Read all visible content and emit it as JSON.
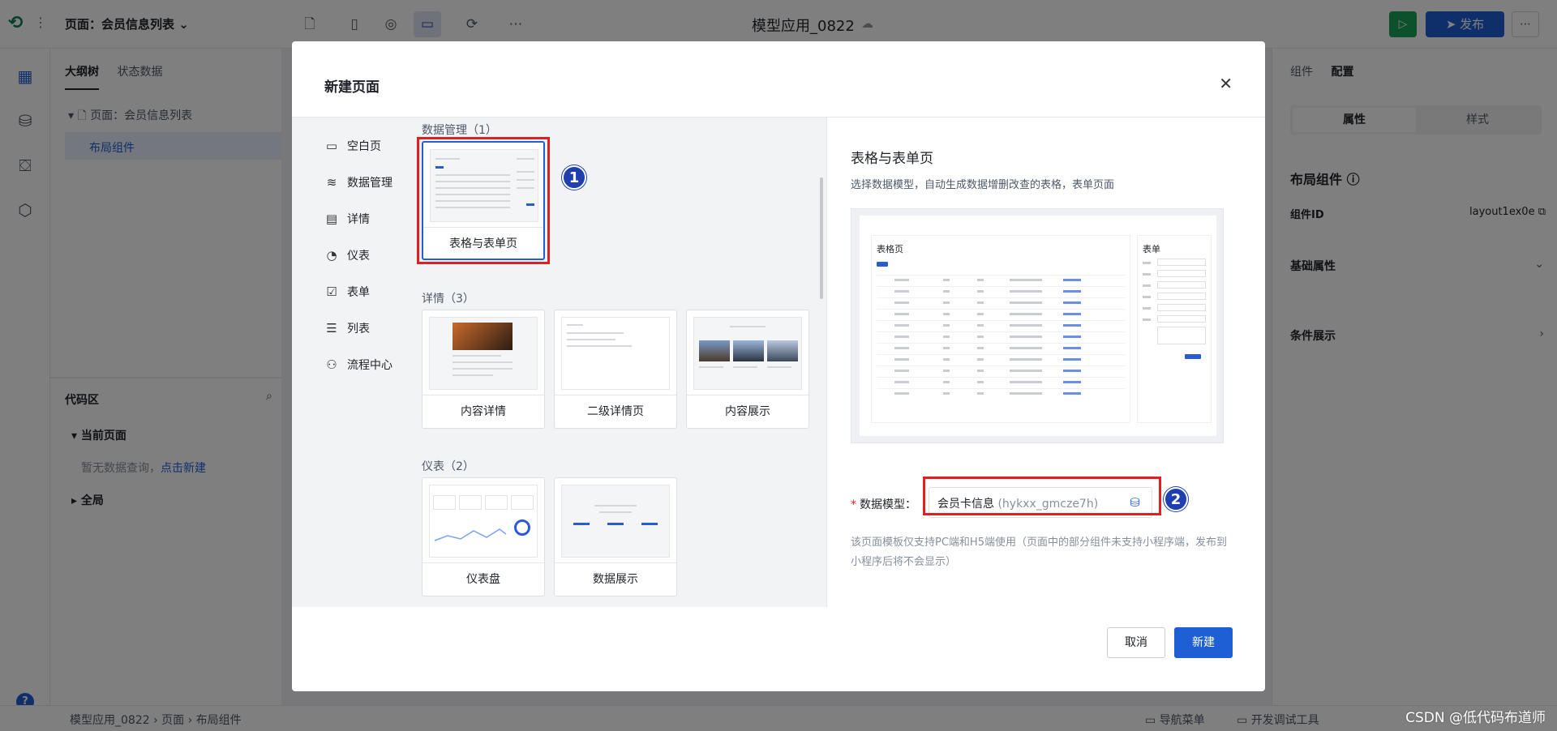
{
  "editor": {
    "page_selector": "页面：会员信息列表",
    "app_title": "模型应用_0822",
    "publish_label": "发布",
    "left_tabs": [
      "大纲树",
      "状态数据"
    ],
    "tree_page": "页面：会员信息列表",
    "tree_layout": "布局组件",
    "code_zone_title": "代码区",
    "code_current": "当前页面",
    "code_empty_text": "暂无数据查询，",
    "code_empty_link": "点击新建",
    "code_global": "全局",
    "right_tabs": [
      "组件",
      "配置"
    ],
    "seg_props": "属性",
    "seg_style": "样式",
    "component_name": "布局组件",
    "component_id_label": "组件ID",
    "component_id_value": "layout1ex0e",
    "section_basic": "基础属性",
    "section_condition": "条件展示",
    "breadcrumb": [
      "模型应用_0822",
      "页面",
      "布局组件"
    ],
    "bottom_tools": [
      "导航菜单",
      "开发调试工具"
    ],
    "watermark": "CSDN @低代码布道师"
  },
  "modal": {
    "title": "新建页面",
    "categories": [
      {
        "icon": "blank-page-icon",
        "glyph": "▭",
        "label": "空白页"
      },
      {
        "icon": "layers-icon",
        "glyph": "≋",
        "label": "数据管理"
      },
      {
        "icon": "detail-icon",
        "glyph": "▤",
        "label": "详情"
      },
      {
        "icon": "gauge-icon",
        "glyph": "◔",
        "label": "仪表"
      },
      {
        "icon": "checkbox-icon",
        "glyph": "☑",
        "label": "表单"
      },
      {
        "icon": "list-icon",
        "glyph": "☰",
        "label": "列表"
      },
      {
        "icon": "flow-icon",
        "glyph": "⚇",
        "label": "流程中心"
      }
    ],
    "groups": {
      "data_manage": {
        "title": "数据管理（1）",
        "templates": [
          "表格与表单页"
        ]
      },
      "detail": {
        "title": "详情（3）",
        "templates": [
          "内容详情",
          "二级详情页",
          "内容展示"
        ]
      },
      "dashboard": {
        "title": "仪表（2）",
        "templates": [
          "仪表盘",
          "数据展示"
        ]
      }
    },
    "selected": {
      "title": "表格与表单页",
      "description": "选择数据模型，自动生成数据增删改查的表格，表单页面",
      "preview_table_title": "表格页",
      "preview_form_title": "表单"
    },
    "data_model_label": "数据模型：",
    "data_model_name": "会员卡信息",
    "data_model_code": "(hykxx_gmcze7h)",
    "note": "该页面模板仅支持PC端和H5端使用（页面中的部分组件未支持小程序端，发布到小程序后将不会显示）",
    "cancel_label": "取消",
    "create_label": "新建",
    "badges": [
      "1",
      "2"
    ]
  }
}
